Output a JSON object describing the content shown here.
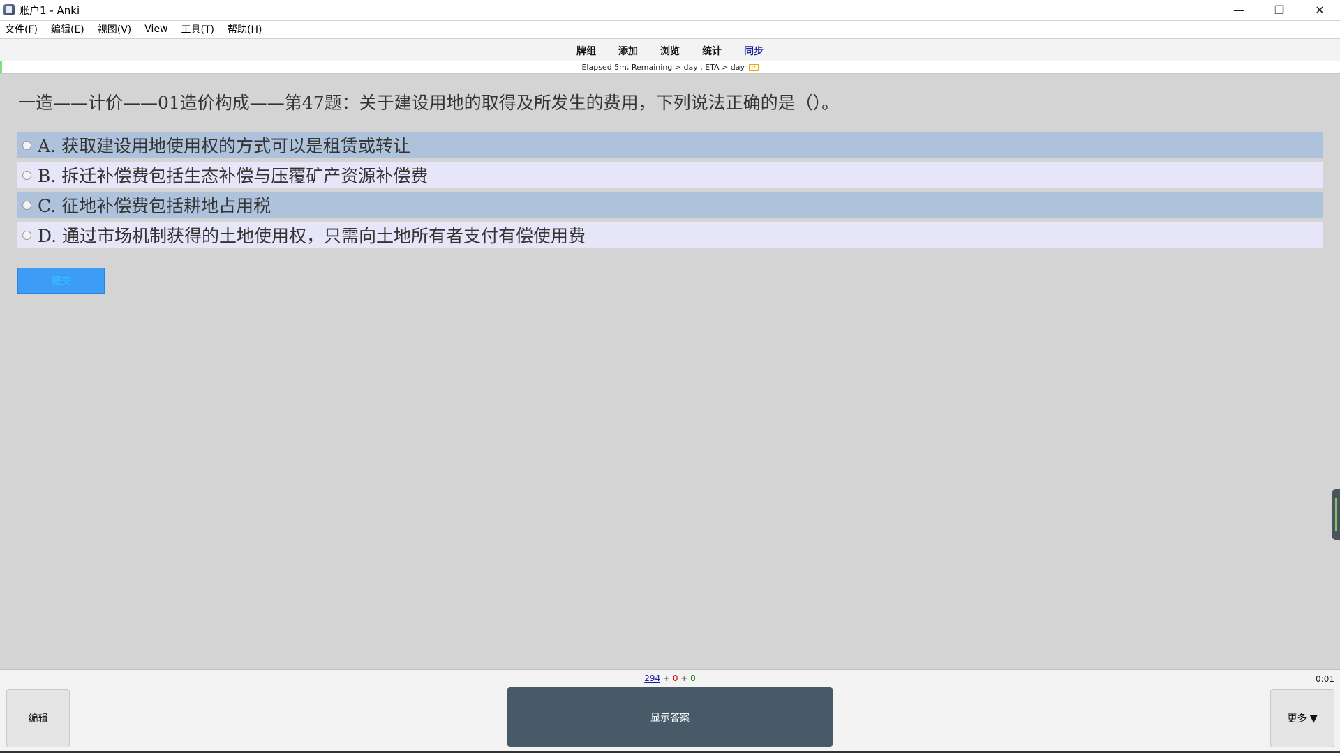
{
  "window": {
    "title": "账户1 - Anki",
    "controls": {
      "minimize": "—",
      "restore": "❐",
      "close": "✕"
    }
  },
  "menu": [
    "文件(F)",
    "编辑(E)",
    "视图(V)",
    "View",
    "工具(T)",
    "帮助(H)"
  ],
  "toolbar": {
    "links": [
      "牌组",
      "添加",
      "浏览",
      "统计",
      "同步"
    ],
    "eta_text": "Elapsed 5m, Remaining > day , ETA > day",
    "eta_icon": "⇄"
  },
  "card": {
    "question": "一造——计价——01造价构成——第47题：关于建设用地的取得及所发生的费用，下列说法正确的是（）。",
    "options": [
      "A. 获取建设用地使用权的方式可以是租赁或转让",
      "B. 拆迁补偿费包括生态补偿与压覆矿产资源补偿费",
      "C. 征地补偿费包括耕地占用税",
      "D. 通过市场机制获得的土地使用权，只需向土地所有者支付有偿使用费"
    ],
    "submit_label": "提交"
  },
  "bottom": {
    "counts": {
      "new": "294",
      "sep": "+",
      "learning": "0",
      "review": "0"
    },
    "timer": "0:01",
    "edit_label": "编辑",
    "show_answer_label": "显示答案",
    "more_label": "更多 ▼"
  },
  "colors": {
    "option_odd": "#aec2dc",
    "option_even": "#e6e6f8",
    "submit": "#3d9cf5",
    "answer_button": "#465a68",
    "count_new": "#1a1ab0",
    "count_learning": "#dd0000",
    "count_review": "#008800"
  }
}
